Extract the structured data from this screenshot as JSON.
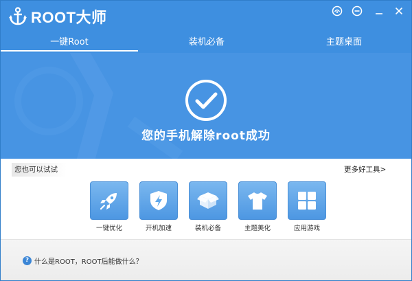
{
  "app": {
    "logo_text": "ROOT大师"
  },
  "window_controls": [
    "skin-icon",
    "feedback-icon",
    "minimize-icon",
    "close-icon"
  ],
  "tabs": [
    {
      "label": "一键Root",
      "active": true
    },
    {
      "label": "装机必备",
      "active": false
    },
    {
      "label": "主题桌面",
      "active": false
    }
  ],
  "hero": {
    "icon": "check-circle-icon",
    "message": "您的手机解除root成功"
  },
  "suggest": {
    "label": "您也可以试试",
    "more_link": "更多好工具>"
  },
  "tools": [
    {
      "label": "一键优化",
      "icon": "rocket-icon"
    },
    {
      "label": "开机加速",
      "icon": "shield-bolt-icon"
    },
    {
      "label": "装机必备",
      "icon": "box-icon"
    },
    {
      "label": "主题美化",
      "icon": "tshirt-icon"
    },
    {
      "label": "应用游戏",
      "icon": "apps-grid-icon"
    }
  ],
  "faq": {
    "icon": "question-icon",
    "icon_glyph": "?",
    "text": "什么是ROOT，ROOT后能做什么？"
  },
  "colors": {
    "primary": "#3e8fe0",
    "hero": "#4794e3",
    "tool_bg": "#5ea7ea"
  }
}
